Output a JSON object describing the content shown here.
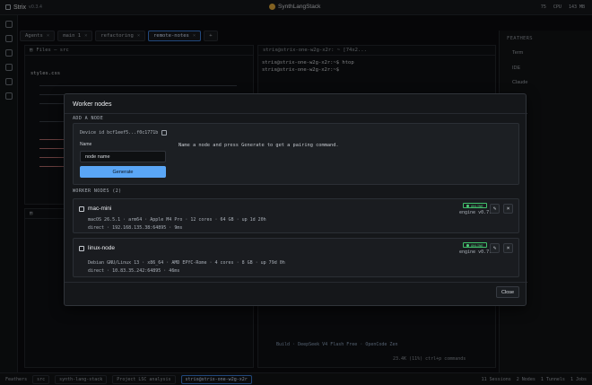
{
  "app": {
    "name": "Strix",
    "version": "v0.3.4",
    "workspace": "SynthLangStack"
  },
  "top_stats": [
    "75",
    "CPU",
    "143 MB"
  ],
  "tabs": [
    {
      "label": "Agents",
      "active": false
    },
    {
      "label": "main 1",
      "active": false
    },
    {
      "label": "refactoring",
      "active": false
    },
    {
      "label": "remote-notes",
      "active": true
    }
  ],
  "terminal": {
    "title": "strix@strix-one-w2g-x2r: ~ [74x2...",
    "line1": "strix@strix-one-w2g-x2r:~$ htop",
    "line2": "strix@strix-one-w2g-x2r:~$ "
  },
  "files_pane": {
    "title": "Files — src",
    "tab": "styles.css"
  },
  "right_sidebar": {
    "title": "FEATHERS",
    "items": [
      "Term",
      "IDE",
      "Claude"
    ]
  },
  "modal": {
    "title": "Worker nodes",
    "add_label": "ADD A NODE",
    "device_id": "Device id bcf1eef5...f0c1771b",
    "name_label": "Name",
    "name_placeholder": "node name",
    "generate_label": "Generate",
    "hint": "Name a node and press Generate to get a pairing command.",
    "nodes_label": "WORKER NODES",
    "nodes_count": "(2)",
    "close_label": "Close",
    "nodes": [
      {
        "name": "mac-mini",
        "status": "ONLINE",
        "engine": "engine v0.7.4",
        "spec": "macOS 26.5.1 · arm64 · Apple M4 Pro · 12 cores · 64 GB · up 1d 20h",
        "conn": "direct · 192.168.135.38:64895 · 9ms"
      },
      {
        "name": "linux-node",
        "status": "ONLINE",
        "engine": "engine v0.7.4",
        "spec": "Debian GNU/Linux 13 · x86_64 · AMD EPYC-Rome · 4 cores · 8 GB · up 79d 0h",
        "conn": "direct · 10.83.35.242:64895 · 46ms"
      }
    ]
  },
  "chat": {
    "build_line": "Build · DeepSeek V4 Flash Free · OpenCode Zen",
    "status": "23.4K (11%) ctrl+p commands"
  },
  "bottom_bar": [
    "Feathers",
    "src",
    "synth-lang-stack",
    "Project LSC analysis",
    "strix@strix-one-w2g-x2r",
    "11 Sessions",
    "2 Nodes",
    "1 Tunnels",
    "1 Jobs"
  ],
  "colors": {
    "accent": "#5aa6f6",
    "online": "#4fd07a"
  }
}
